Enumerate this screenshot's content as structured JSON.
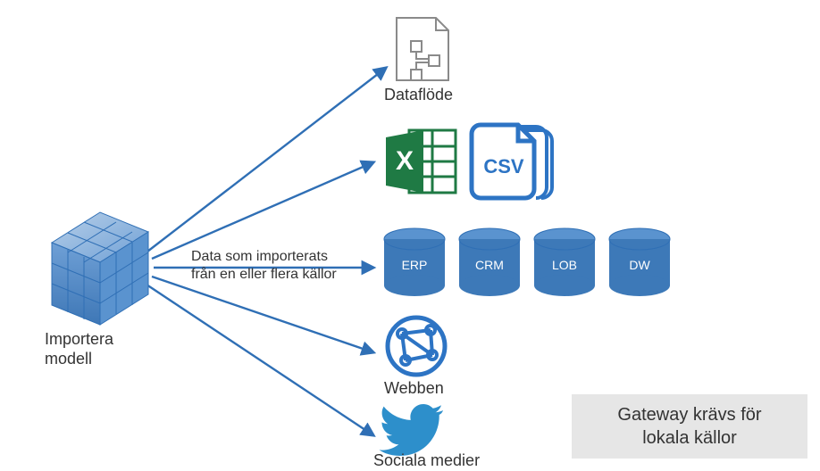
{
  "source": {
    "label": "Importera\nmodell"
  },
  "arrow_label": "Data som importerats\nfrån en eller flera källor",
  "targets": {
    "dataflow": {
      "label": "Dataflöde"
    },
    "files": {
      "excel_icon": "Excel",
      "csv_label": "CSV"
    },
    "dbs": [
      {
        "id": "erp",
        "label": "ERP"
      },
      {
        "id": "crm",
        "label": "CRM"
      },
      {
        "id": "lob",
        "label": "LOB"
      },
      {
        "id": "dw",
        "label": "DW"
      }
    ],
    "web": {
      "label": "Webben"
    },
    "social": {
      "label": "Sociala medier"
    }
  },
  "note": "Gateway krävs för\nlokala källor",
  "colors": {
    "arrow": "#2f6fb5",
    "db": "#3d79b8",
    "excel_green": "#1f7a44",
    "excel_dark": "#0f6a3a",
    "csv_blue": "#2d74c4",
    "web_blue": "#2d74c4",
    "twitter": "#2d8fcb",
    "cube_fill": "#5a93cf",
    "cube_line": "#2f6fb5",
    "doc_gray": "#8a8a8a"
  }
}
